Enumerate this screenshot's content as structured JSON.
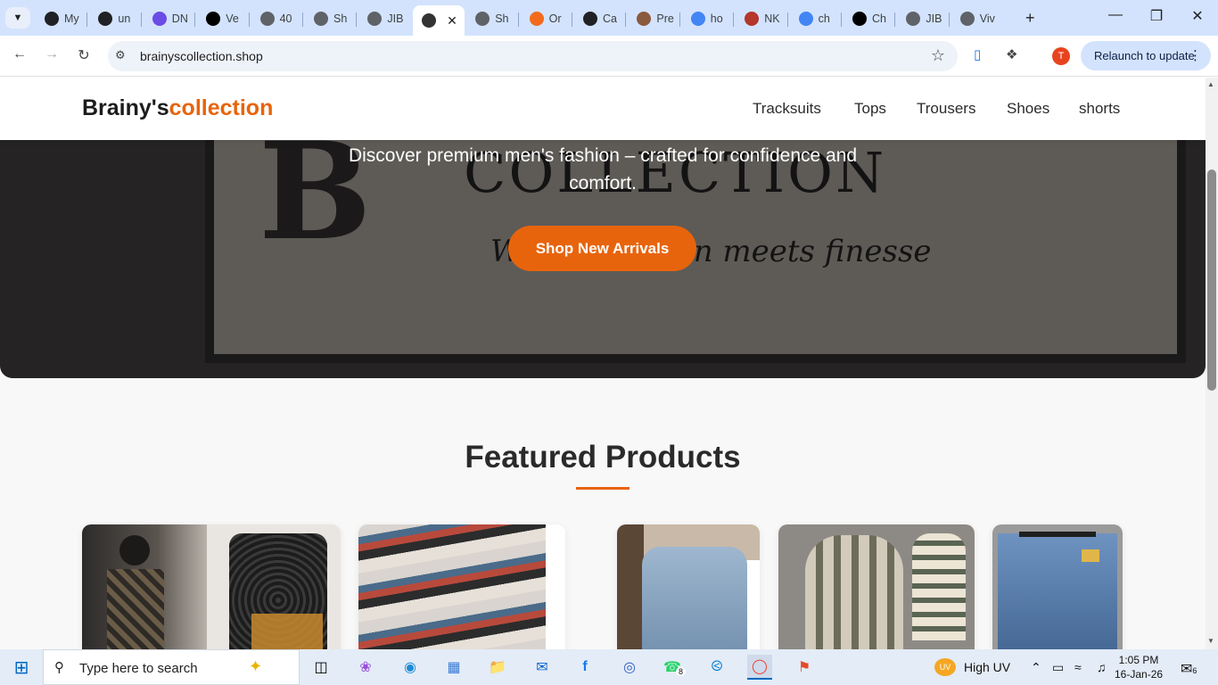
{
  "browser": {
    "tabs": [
      {
        "label": "My",
        "icon": "openai-icon",
        "color": "#202124"
      },
      {
        "label": "un",
        "icon": "github-icon",
        "color": "#202124"
      },
      {
        "label": "DN",
        "icon": "dn-icon",
        "color": "#6b4ce6"
      },
      {
        "label": "Ve",
        "icon": "vercel-icon",
        "color": "#000000"
      },
      {
        "label": "40",
        "icon": "globe-icon",
        "color": "#5f6368"
      },
      {
        "label": "Sh",
        "icon": "globe-search-icon",
        "color": "#5f6368"
      },
      {
        "label": "JIB",
        "icon": "globe-icon",
        "color": "#5f6368"
      },
      {
        "label": "",
        "icon": "brainys-favicon",
        "color": "#333333",
        "active": true
      },
      {
        "label": "Sh",
        "icon": "globe-search-icon",
        "color": "#5f6368"
      },
      {
        "label": "Or",
        "icon": "loading-icon",
        "color": "#f26b1d"
      },
      {
        "label": "Ca",
        "icon": "canva-icon",
        "color": "#202124"
      },
      {
        "label": "Pre",
        "icon": "image-icon",
        "color": "#8a5a3c"
      },
      {
        "label": "ho",
        "icon": "google-icon",
        "color": "#4285f4"
      },
      {
        "label": "NK",
        "icon": "image-icon",
        "color": "#b5362a"
      },
      {
        "label": "ch",
        "icon": "google-icon",
        "color": "#4285f4"
      },
      {
        "label": "Ch",
        "icon": "chatgpt-icon",
        "color": "#000000"
      },
      {
        "label": "JIB",
        "icon": "globe-icon",
        "color": "#5f6368"
      },
      {
        "label": "Viv",
        "icon": "globe-icon",
        "color": "#5f6368"
      }
    ],
    "url": "brainyscollection.shop",
    "relaunch_label": "Relaunch to update",
    "profile_initial": "T"
  },
  "site": {
    "logo_part1": "Brainy's",
    "logo_part2": "collection",
    "nav": [
      "Tracksuits",
      "Tops",
      "Trousers",
      "Shoes",
      "shorts"
    ],
    "hero": {
      "tagline": "Discover premium men's fashion – crafted for confidence and comfort.",
      "cta_label": "Shop New Arrivals"
    },
    "featured_title": "Featured Products",
    "products": [
      {
        "name": "product-patterned-jacket"
      },
      {
        "name": "product-sneakers"
      },
      {
        "name": "product-jeans"
      },
      {
        "name": "product-plaid-hoodie"
      },
      {
        "name": "product-denim"
      }
    ],
    "colors": {
      "accent": "#e8640c",
      "text": "#2a2a2a"
    }
  },
  "taskbar": {
    "search_placeholder": "Type here to search",
    "weather_badge": "UV",
    "weather": "High UV",
    "whatsapp_badge": "8",
    "notification_badge": "6",
    "time": "1:05 PM",
    "date": "16-Jan-26"
  }
}
